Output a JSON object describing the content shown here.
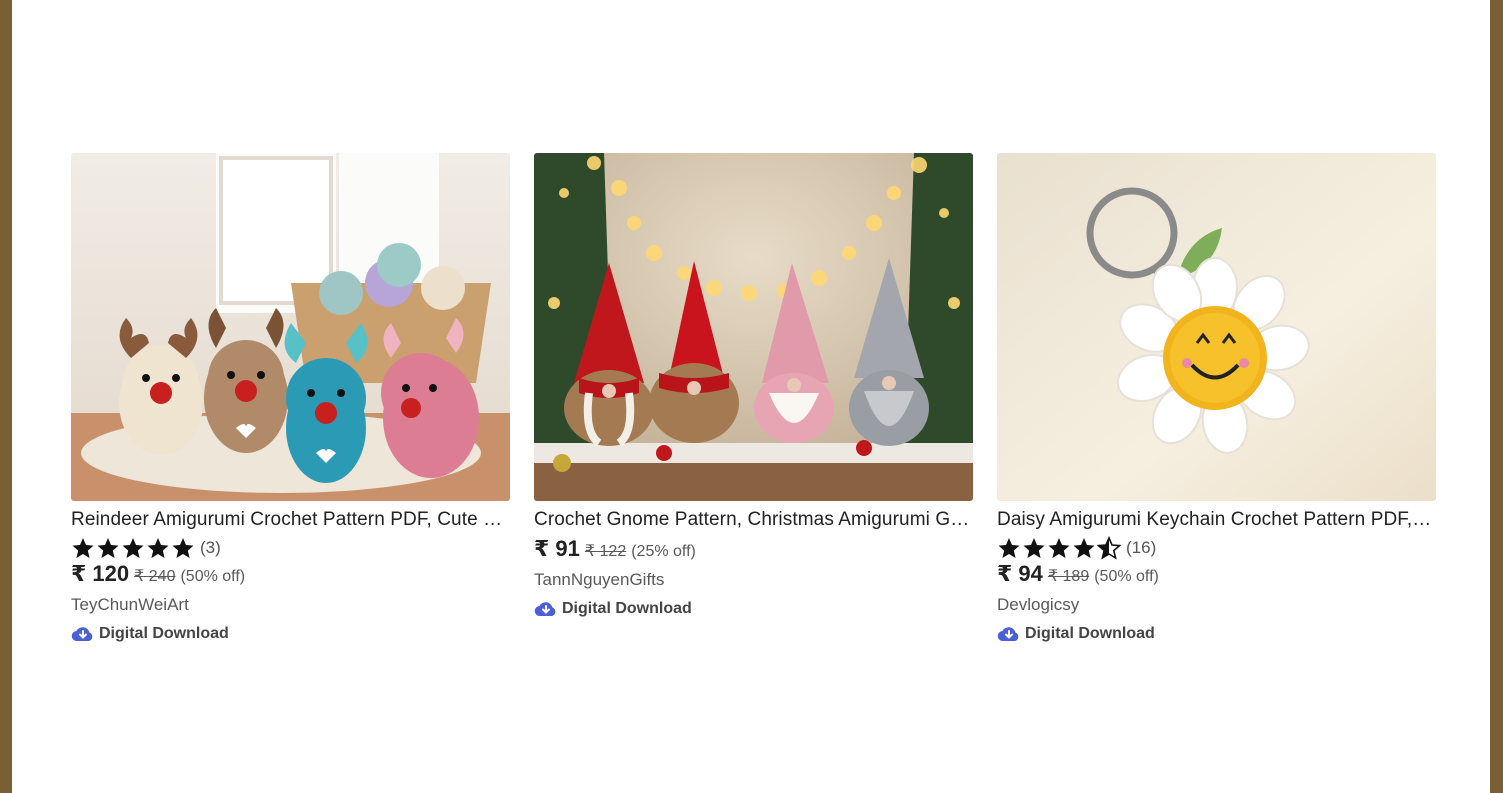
{
  "products": [
    {
      "title": "Reindeer Amigurumi Crochet Pattern PDF, Cute Deer Plush Toy, Christmas Crochet Pattern",
      "rating_count": "(3)",
      "rating": 5,
      "price": "₹ 120",
      "original_price": "₹ 240",
      "discount": "(50% off)",
      "shop": "TeyChunWeiArt",
      "badge": "Digital Download"
    },
    {
      "title": "Crochet Gnome Pattern, Christmas Amigurumi Gnome Family",
      "price": "₹ 91",
      "original_price": "₹ 122",
      "discount": "(25% off)",
      "shop": "TannNguyenGifts",
      "badge": "Digital Download"
    },
    {
      "title": "Daisy Amigurumi Keychain Crochet Pattern PDF, Smiley Flower",
      "rating_count": "(16)",
      "rating": 4.5,
      "price": "₹ 94",
      "original_price": "₹ 189",
      "discount": "(50% off)",
      "shop": "Devlogicsy",
      "badge": "Digital Download"
    }
  ],
  "colors": {
    "download_icon": "#4a5fd8",
    "star": "#111111"
  }
}
